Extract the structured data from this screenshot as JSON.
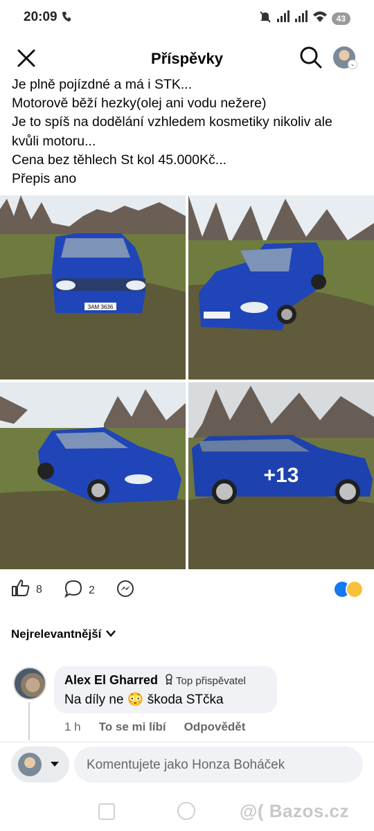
{
  "status": {
    "time": "20:09",
    "battery": "43"
  },
  "header": {
    "title": "Příspěvky"
  },
  "post": {
    "lines": [
      "Je plně pojízdné a má i STK...",
      "Motorově běží hezky(olej ani vodu nežere)",
      "Je to spíš na dodělání vzhledem kosmetiky nikoliv ale",
      "kvůli motoru...",
      "Cena bez těhlech St kol 45.000Kč...",
      "Přepis ano"
    ]
  },
  "gallery": {
    "more_count": "+13",
    "plate": "3AM 3636"
  },
  "reactions": {
    "likes": "8",
    "comments": "2"
  },
  "comments": {
    "sort_label": "Nejrelevantnější",
    "items": [
      {
        "author": "Alex El Gharred",
        "badge": "Top přispěvatel",
        "text": "Na díly ne 😳 škoda STčka",
        "time": "1 h",
        "like_label": "To se mi líbí",
        "reply_label": "Odpovědět"
      }
    ]
  },
  "composer": {
    "placeholder": "Komentujete jako Honza Boháček"
  },
  "watermark": "@( Bazos.cz",
  "colors": {
    "accent": "#1877f2",
    "car_blue": "#1f45b8",
    "grass": "#6b7a3c",
    "sky": "#e9eef2"
  }
}
